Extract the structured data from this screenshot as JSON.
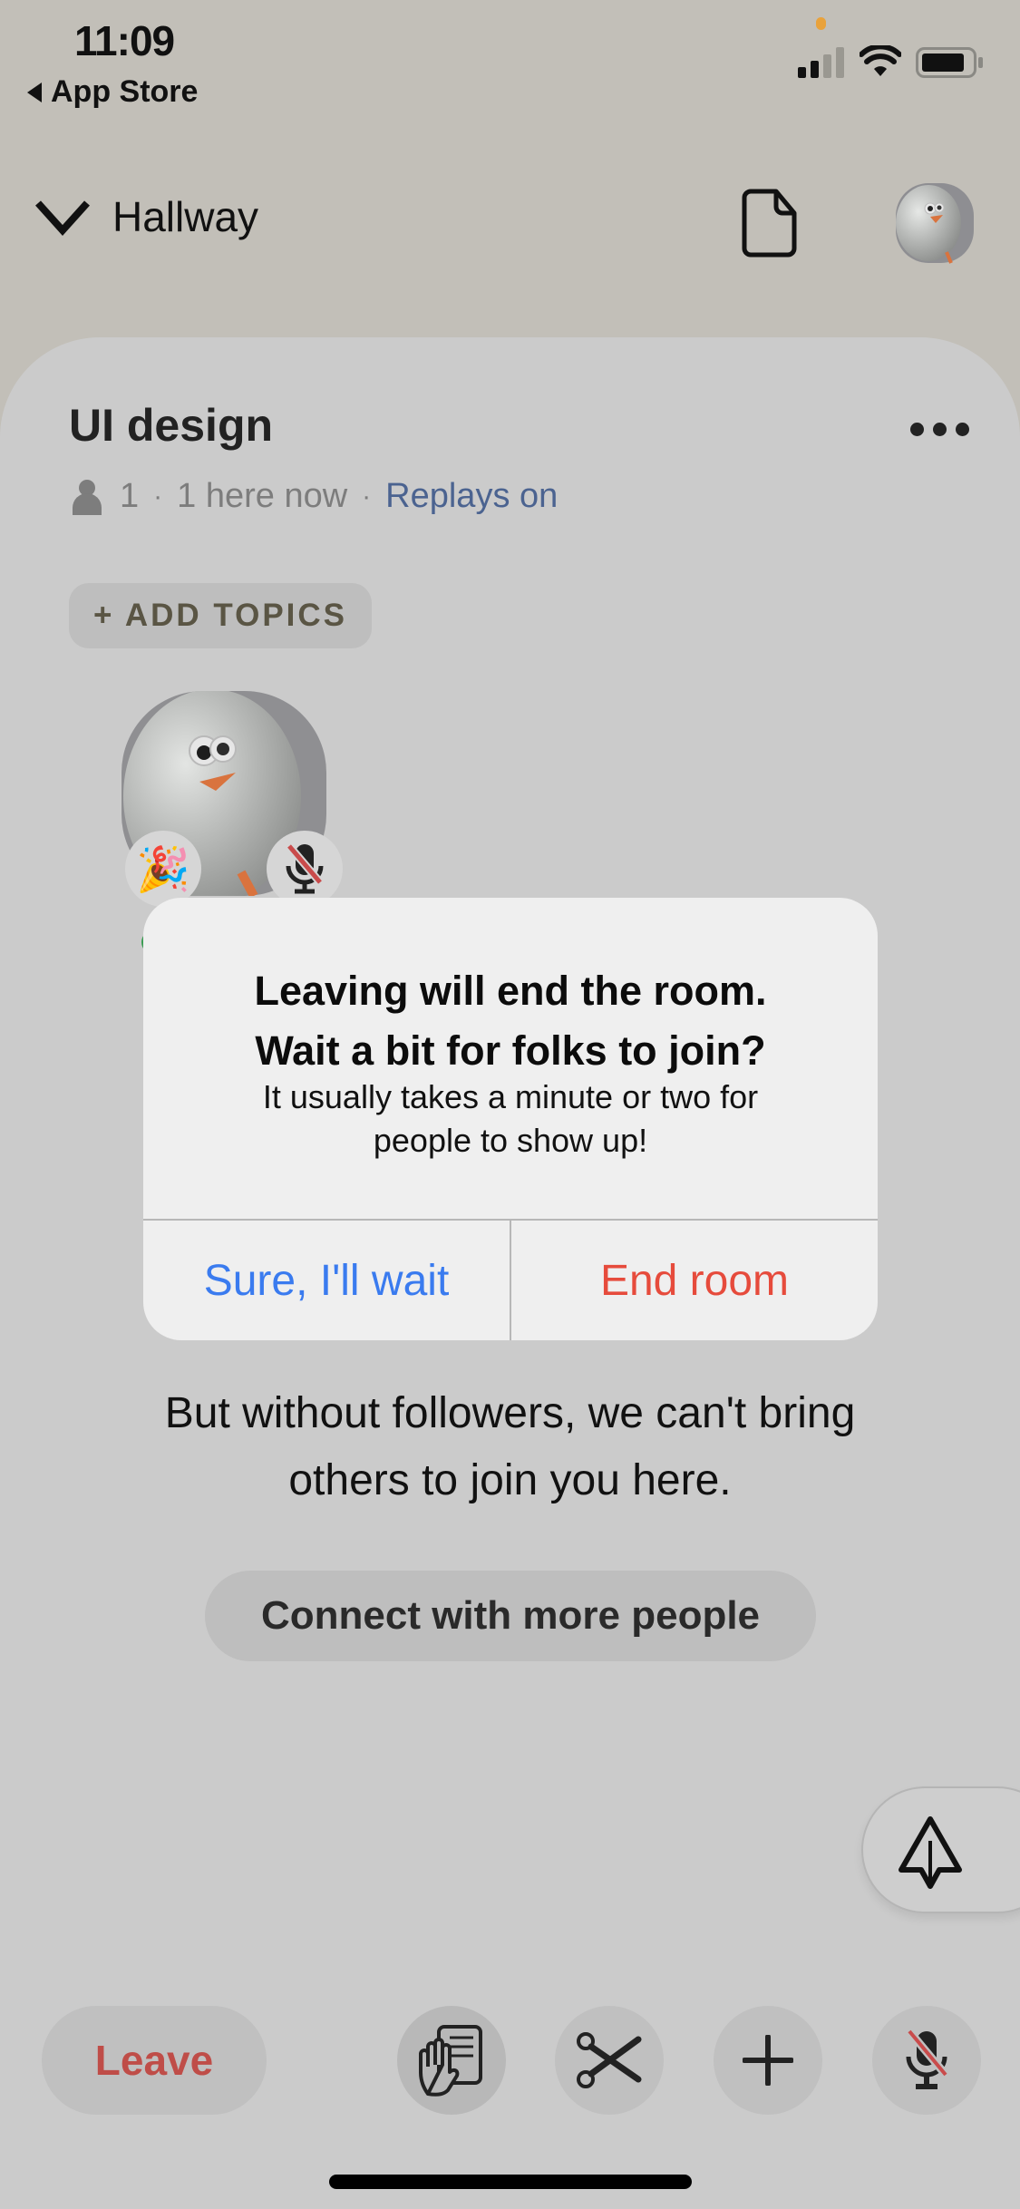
{
  "status_bar": {
    "time": "11:09",
    "back_label": "App Store",
    "icons": [
      "orange-privacy-dot",
      "signal-icon",
      "wifi-icon",
      "battery-icon"
    ]
  },
  "header": {
    "hallway_label": "Hallway",
    "icons": [
      "chevron-down-icon",
      "document-icon",
      "profile-avatar"
    ]
  },
  "room": {
    "title": "UI design",
    "listener_count": "1",
    "here_now": "1 here now",
    "separator": "·",
    "replays": "Replays on",
    "add_topics": "+ ADD TOPICS"
  },
  "speaker": {
    "badge_emoji": "🎉",
    "muted": true,
    "colors": {
      "online": "#3a9c52",
      "mute_slash": "#c94b4b"
    }
  },
  "alert": {
    "title_line1": "Leaving will end the room.",
    "title_line2": "Wait a bit for folks to join?",
    "message_line1": "It usually takes a minute or two for",
    "message_line2": "people to show up!",
    "wait_label": "Sure, I'll wait",
    "end_label": "End room",
    "colors": {
      "wait": "#3a7bef",
      "end": "#e64b3c"
    }
  },
  "empty_state": {
    "line1": "But without followers, we can't bring",
    "line2": "others to join you here.",
    "connect_label": "Connect with more people"
  },
  "toolbar": {
    "leave_label": "Leave",
    "buttons": [
      "raise-hand-icon",
      "clip-scissors-icon",
      "add-icon",
      "mic-muted-icon"
    ],
    "share_icon": "paper-plane-icon",
    "colors": {
      "leave": "#bf4d48"
    }
  }
}
